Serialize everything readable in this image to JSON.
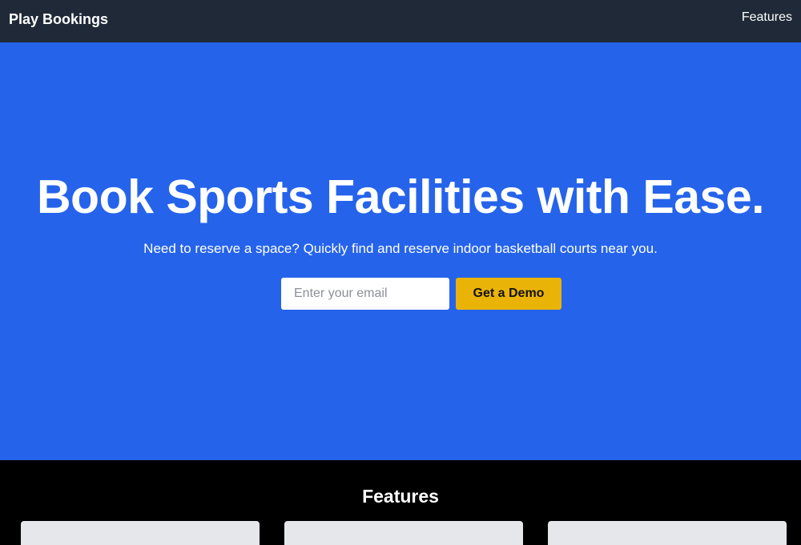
{
  "nav": {
    "brand": "Play Bookings",
    "links": [
      "Features"
    ]
  },
  "hero": {
    "title": "Book Sports Facilities with Ease.",
    "subtitle": "Need to reserve a space? Quickly find and reserve indoor basketball courts near you.",
    "email_placeholder": "Enter your email",
    "cta_label": "Get a Demo"
  },
  "features": {
    "title": "Features"
  },
  "colors": {
    "nav_bg": "#1f2937",
    "hero_bg": "#2563eb",
    "cta_bg": "#eab308",
    "features_bg": "#000000",
    "card_bg": "#e5e7eb"
  }
}
